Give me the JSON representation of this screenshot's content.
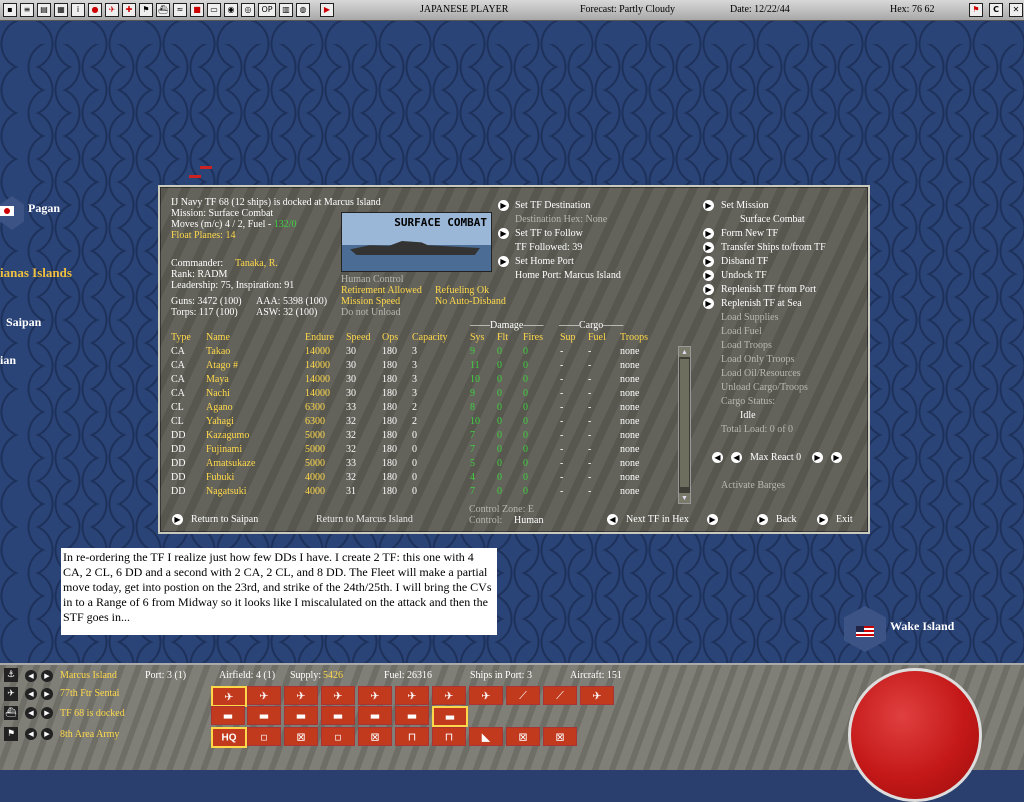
{
  "topbar": {
    "side": "JAPANESE PLAYER",
    "forecast": "Forecast: Partly Cloudy",
    "date": "Date: 12/22/44",
    "hex": "Hex: 76 62"
  },
  "map": {
    "labels": {
      "pagan": "Pagan",
      "marianas": "ianas Islands",
      "saipan": "Saipan",
      "tinian": "ian",
      "wake": "Wake Island"
    }
  },
  "panel": {
    "header": {
      "line1": "IJ Navy TF 68 (12 ships) is docked at Marcus Island",
      "mission": "Mission: Surface Combat",
      "moves_prefix": "Moves (m/c) 4 / 2, Fuel - ",
      "fuel": "132/0",
      "float_planes": "Float Planes: 14",
      "commander_label": "Commander:",
      "commander_name": "Tanaka, R.",
      "rank": "Rank: RADM",
      "leadership": "Leadership: 75, Inspiration: 91",
      "guns": "Guns: 3472 (100)",
      "aaa": "AAA: 5398 (100)",
      "torps": "Torps: 117 (100)",
      "asw": "ASW: 32 (100)"
    },
    "image_caption": "SURFACE COMBAT",
    "control": {
      "human_control": "Human Control",
      "retirement": "Retirement Allowed",
      "refueling": "Refueling Ok",
      "mission_speed": "Mission Speed",
      "no_auto_disband": "No Auto-Disband",
      "do_not_unload": "Do not Unload"
    },
    "middle": {
      "set_tf_destination": "Set TF Destination",
      "destination_hex": "Destination Hex: None",
      "set_tf_to_follow": "Set TF to Follow",
      "tf_followed": "TF Followed: 39",
      "set_home_port": "Set Home Port",
      "home_port": "Home Port: Marcus Island"
    },
    "right_menu": {
      "set_mission": "Set Mission",
      "mission_value": "Surface Combat",
      "form_new_tf": "Form New TF",
      "transfer": "Transfer Ships to/from TF",
      "disband": "Disband TF",
      "undock": "Undock TF",
      "replenish_port": "Replenish TF from Port",
      "replenish_sea": "Replenish TF at Sea",
      "load_supplies": "Load Supplies",
      "load_fuel": "Load Fuel",
      "load_troops": "Load Troops",
      "load_only_troops": "Load Only Troops",
      "load_oil": "Load Oil/Resources",
      "unload": "Unload Cargo/Troops",
      "cargo_status": "Cargo Status:",
      "cargo_value": "Idle",
      "total_load": "Total Load: 0 of 0",
      "max_react": "Max React 0",
      "activate_barges": "Activate Barges"
    },
    "table": {
      "group_damage": "Damage",
      "group_cargo": "Cargo",
      "headers": [
        "Type",
        "Name",
        "Endure",
        "Speed",
        "Ops",
        "Capacity",
        "Sys",
        "Flt",
        "Fires",
        "Sup",
        "Fuel",
        "Troops"
      ],
      "rows": [
        [
          "CA",
          "Takao",
          "14000",
          "30",
          "180",
          "3",
          "9",
          "0",
          "0",
          "-",
          "-",
          "none"
        ],
        [
          "CA",
          "Atago #",
          "14000",
          "30",
          "180",
          "3",
          "11",
          "0",
          "0",
          "-",
          "-",
          "none"
        ],
        [
          "CA",
          "Maya",
          "14000",
          "30",
          "180",
          "3",
          "10",
          "0",
          "0",
          "-",
          "-",
          "none"
        ],
        [
          "CA",
          "Nachi",
          "14000",
          "30",
          "180",
          "3",
          "9",
          "0",
          "0",
          "-",
          "-",
          "none"
        ],
        [
          "CL",
          "Agano",
          "6300",
          "33",
          "180",
          "2",
          "8",
          "0",
          "0",
          "-",
          "-",
          "none"
        ],
        [
          "CL",
          "Yahagi",
          "6300",
          "32",
          "180",
          "2",
          "10",
          "0",
          "0",
          "-",
          "-",
          "none"
        ],
        [
          "DD",
          "Kazagumo",
          "5000",
          "32",
          "180",
          "0",
          "7",
          "0",
          "0",
          "-",
          "-",
          "none"
        ],
        [
          "DD",
          "Fujinami",
          "5000",
          "32",
          "180",
          "0",
          "7",
          "0",
          "0",
          "-",
          "-",
          "none"
        ],
        [
          "DD",
          "Amatsukaze",
          "5000",
          "33",
          "180",
          "0",
          "5",
          "0",
          "0",
          "-",
          "-",
          "none"
        ],
        [
          "DD",
          "Fubuki",
          "4000",
          "32",
          "180",
          "0",
          "4",
          "0",
          "0",
          "-",
          "-",
          "none"
        ],
        [
          "DD",
          "Nagatsuki",
          "4000",
          "31",
          "180",
          "0",
          "7",
          "0",
          "0",
          "-",
          "-",
          "none"
        ]
      ]
    },
    "footer": {
      "return_saipan": "Return to Saipan",
      "return_marcus": "Return to Marcus Island",
      "control_zone": "Control Zone: E",
      "control": "Control:",
      "control_value": "Human",
      "next_tf": "Next TF in Hex",
      "back": "Back",
      "exit": "Exit"
    }
  },
  "note": "In re-ordering the TF I realize just how few DDs I have.  I create 2 TF:  this one with 4 CA, 2 CL, 6 DD and a second with 2 CA, 2 CL, and 8 DD.  The Fleet will make a partial move today, get into postion on the 23rd, and strike of the 24th/25th.  I will bring the CVs in to a Range of 6 from Midway so it looks like I miscalulated on the attack and then the STF goes in...",
  "bottom": {
    "base": "Marcus Island",
    "port": "Port: 3 (1)",
    "airfield": "Airfield: 4 (1)",
    "supply_label": "Supply:",
    "supply_value": "5426",
    "fuel": "Fuel: 26316",
    "ships_in_port": "Ships in Port: 3",
    "aircraft": "Aircraft: 151",
    "air_unit": "77th Ftr Sentai",
    "tf_status": "TF 68 is docked",
    "army": "8th Area Army",
    "hq_label": "HQ"
  },
  "colors": {
    "accent": "#ffd84a",
    "green": "#3fd040",
    "map": "#2b4478",
    "slot": "#c23a1e"
  }
}
